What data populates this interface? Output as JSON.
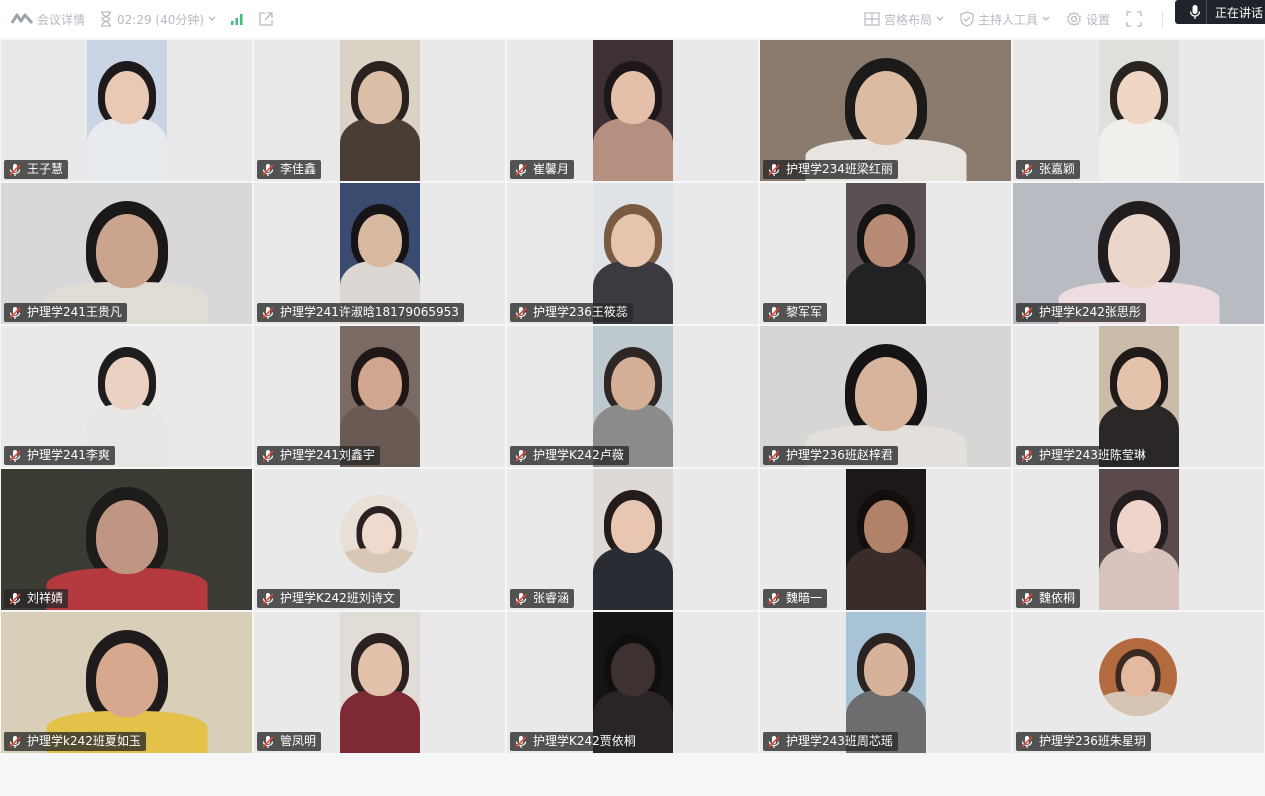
{
  "topbar": {
    "meeting_details": "会议详情",
    "timer": "02:29 (40分钟)",
    "layout": "宫格布局",
    "host_tools": "主持人工具",
    "settings": "设置",
    "speaking": "正在讲话"
  },
  "participants": [
    {
      "name": "王子慧",
      "bg": "#c9d4e4",
      "style": "portrait",
      "skin": "#e9c9b4",
      "hair": "#1e1a1c",
      "shirt": "#e7eaee"
    },
    {
      "name": "李佳鑫",
      "bg": "#d9d2c5",
      "style": "portrait",
      "skin": "#dcbfa8",
      "hair": "#2a221f",
      "shirt": "#4a3d35"
    },
    {
      "name": "崔馨月",
      "bg": "#3d3136",
      "style": "portrait",
      "skin": "#e4c0aa",
      "hair": "#1d1719",
      "shirt": "#b58f80"
    },
    {
      "name": "护理学234班梁红丽",
      "bg": "#8a7b6e",
      "style": "full",
      "skin": "#dcbba3",
      "hair": "#1d1a1a",
      "shirt": "#e8e5e0"
    },
    {
      "name": "张嘉颖",
      "bg": "#dfe0db",
      "style": "portrait",
      "skin": "#efd6c5",
      "hair": "#2a2420",
      "shirt": "#f1efec"
    },
    {
      "name": "护理学241王贵凡",
      "bg": "#d8d8da",
      "style": "full",
      "skin": "#caa48d",
      "hair": "#1a1819",
      "shirt": "#e2dcd6"
    },
    {
      "name": "护理学241许淑晗18179065953",
      "bg": "#3b4b70",
      "style": "portrait",
      "skin": "#d8b9a2",
      "hair": "#161416",
      "shirt": "#dcd7d2"
    },
    {
      "name": "护理学236王筱蕊",
      "bg": "#dfe3e7",
      "style": "portrait",
      "skin": "#e7c4ad",
      "hair": "#7b5a44",
      "shirt": "#3b3a40"
    },
    {
      "name": "黎军军",
      "bg": "#5b5152",
      "style": "portrait",
      "skin": "#b88b74",
      "hair": "#161313",
      "shirt": "#222225"
    },
    {
      "name": "护理学k242张思彤",
      "bg": "#b8bcc2",
      "style": "full",
      "skin": "#ecd5c9",
      "hair": "#211c1d",
      "shirt": "#eddde0"
    },
    {
      "name": "护理学241李爽",
      "bg": "#e9e9e7",
      "style": "portrait",
      "skin": "#ead1c1",
      "hair": "#1f1c1d",
      "shirt": "#e6e6e4"
    },
    {
      "name": "护理学241刘鑫宇",
      "bg": "#7a6a64",
      "style": "portrait",
      "skin": "#d0a68f",
      "hair": "#1f1716",
      "shirt": "#6a5a54"
    },
    {
      "name": "护理学K242卢薇",
      "bg": "#bdc8cf",
      "style": "portrait",
      "skin": "#d4ae95",
      "hair": "#2d2624",
      "shirt": "#8b8b8b"
    },
    {
      "name": "护理学236班赵梓君",
      "bg": "#d7d6d4",
      "style": "full",
      "skin": "#d8b49d",
      "hair": "#161314",
      "shirt": "#e3e0dc"
    },
    {
      "name": "护理学243班陈莹琳",
      "bg": "#cbbca9",
      "style": "portrait",
      "skin": "#e5c2ac",
      "hair": "#201a18",
      "shirt": "#2b2727"
    },
    {
      "name": "刘祥婧",
      "bg": "#3b3a33",
      "style": "full",
      "skin": "#bf9584",
      "hair": "#1e1b1b",
      "shirt": "#b53a3f"
    },
    {
      "name": "护理学K242班刘诗文",
      "bg": "#e8dfd6",
      "style": "avatar",
      "skin": "#f0d9cd",
      "hair": "#2a2220",
      "shirt": "#d9c7b6"
    },
    {
      "name": "张睿涵",
      "bg": "#dfd9d6",
      "style": "portrait",
      "skin": "#e8c6b1",
      "hair": "#231c1b",
      "shirt": "#2a2c33"
    },
    {
      "name": "魏暗一",
      "bg": "#1c1817",
      "style": "portrait",
      "skin": "#b0826a",
      "hair": "#120e0d",
      "shirt": "#3a2c28"
    },
    {
      "name": "魏依桐",
      "bg": "#5a4b4a",
      "style": "portrait",
      "skin": "#efd5c9",
      "hair": "#231d1f",
      "shirt": "#d9c3bd"
    },
    {
      "name": "护理学k242班夏如玉",
      "bg": "#d9cfb8",
      "style": "full",
      "skin": "#d6a98f",
      "hair": "#1f1b1c",
      "shirt": "#e4c24a"
    },
    {
      "name": "管凤明",
      "bg": "#e2dcd6",
      "style": "portrait",
      "skin": "#e2c2ab",
      "hair": "#2a2120",
      "shirt": "#7c2b35"
    },
    {
      "name": "护理学K242贾依桐",
      "bg": "#151414",
      "style": "portrait",
      "skin": "#3d3230",
      "hair": "#0f0d0d",
      "shirt": "#2a2524"
    },
    {
      "name": "护理学243班周芯瑶",
      "bg": "#a8c3d6",
      "style": "portrait",
      "skin": "#d7b29b",
      "hair": "#2a2322",
      "shirt": "#6d6d70"
    },
    {
      "name": "护理学236班朱星玥",
      "bg": "#b36a3e",
      "style": "avatar",
      "skin": "#e3b9a0",
      "hair": "#3a2a22",
      "shirt": "#d7c5b4"
    }
  ]
}
